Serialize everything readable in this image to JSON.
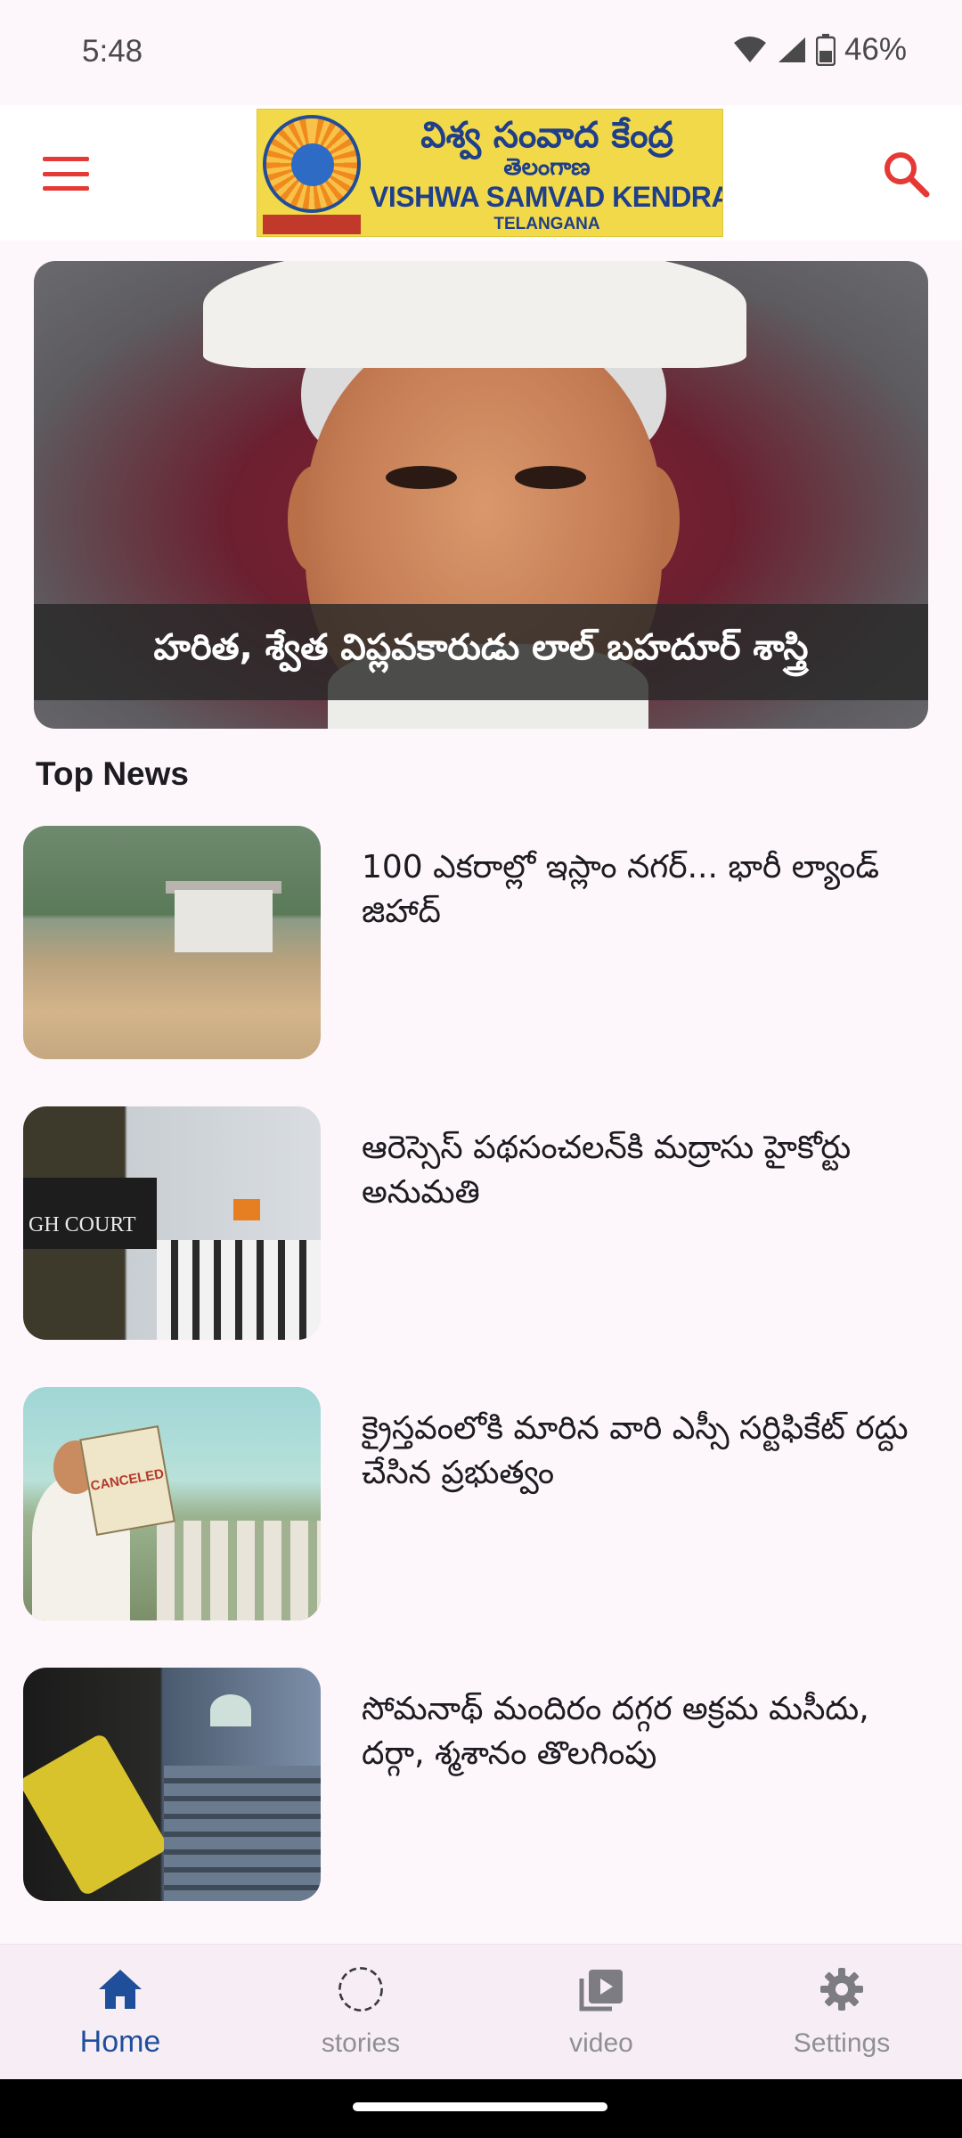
{
  "status_bar": {
    "time": "5:48",
    "battery": "46%"
  },
  "header": {
    "logo_telugu": "విశ్వ సంవాద కేంద్ర",
    "logo_telugu_sub": "తెలంగాణ",
    "logo_english": "VISHWA SAMVAD KENDRA",
    "logo_english_sub": "TELANGANA",
    "accent_color": "#e53935"
  },
  "hero": {
    "caption": "హరిత, శ్వేత విప్లవకారుడు లాల్ బహదూర్ శాస్త్రి"
  },
  "section": {
    "title": "Top News"
  },
  "news": [
    {
      "title": "100 ఎకరాల్లో ఇస్లాం నగర్... భారీ ల్యాండ్ జిహాద్"
    },
    {
      "title": "ఆరెస్సెస్ పథసంచలన్‌కి మద్రాసు హైకోర్టు అనుమతి",
      "thumb_text": "GH COURT"
    },
    {
      "title": "క్రైస్తవంలోకి మారిన వారి ఎస్సీ సర్టిఫికేట్ రద్దు చేసిన ప్రభుత్వం",
      "thumb_text": "CANCELED"
    },
    {
      "title": "సోమనాథ్ మందిరం దగ్గర అక్రమ మసీదు, దర్గా, శ్మశానం తొలగింపు"
    }
  ],
  "bottom_nav": {
    "items": [
      {
        "label": "Home",
        "icon": "home-icon",
        "active": true
      },
      {
        "label": "stories",
        "icon": "stories-icon",
        "active": false
      },
      {
        "label": "video",
        "icon": "video-icon",
        "active": false
      },
      {
        "label": "Settings",
        "icon": "gear-icon",
        "active": false
      }
    ],
    "active_color": "#1f4f9a"
  }
}
